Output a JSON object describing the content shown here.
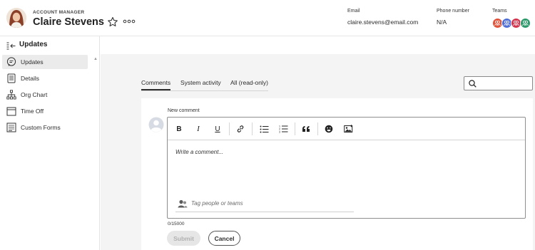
{
  "header": {
    "role": "ACCOUNT MANAGER",
    "name": "Claire Stevens",
    "email_label": "Email",
    "email_value": "claire.stevens@email.com",
    "phone_label": "Phone number",
    "phone_value": "N/A",
    "teams_label": "Teams",
    "team_badges": [
      {
        "color": "#e0533a",
        "icon": "team-icon"
      },
      {
        "color": "#4f6fd6",
        "icon": "team-icon"
      },
      {
        "color": "#d4364f",
        "icon": "team-icon"
      },
      {
        "color": "#2e9a6b",
        "icon": "team-icon"
      }
    ]
  },
  "sidebar": {
    "title": "Updates",
    "items": [
      {
        "label": "Updates",
        "icon": "chat-bubble-icon",
        "active": true
      },
      {
        "label": "Details",
        "icon": "document-icon",
        "active": false
      },
      {
        "label": "Org Chart",
        "icon": "org-chart-icon",
        "active": false
      },
      {
        "label": "Time Off",
        "icon": "calendar-icon",
        "active": false
      },
      {
        "label": "Custom Forms",
        "icon": "form-icon",
        "active": false
      }
    ]
  },
  "tabs": [
    {
      "label": "Comments",
      "active": true
    },
    {
      "label": "System activity",
      "active": false
    },
    {
      "label": "All (read-only)",
      "active": false
    }
  ],
  "search": {
    "placeholder": ""
  },
  "composer": {
    "label": "New comment",
    "placeholder": "Write a comment...",
    "tag_placeholder": "Tag people or teams",
    "counter": "0/15000",
    "submit_label": "Submit",
    "cancel_label": "Cancel",
    "toolbar": [
      {
        "name": "bold-button",
        "glyph": "B"
      },
      {
        "name": "italic-button",
        "glyph": "I"
      },
      {
        "name": "underline-button",
        "glyph": "U"
      },
      {
        "name": "link-button",
        "icon": "link-icon"
      },
      {
        "name": "bulleted-list-button",
        "icon": "bullet-list-icon"
      },
      {
        "name": "numbered-list-button",
        "icon": "numbered-list-icon"
      },
      {
        "name": "quote-button",
        "icon": "quote-icon"
      },
      {
        "name": "emoji-button",
        "icon": "emoji-icon"
      },
      {
        "name": "insert-image-button",
        "icon": "image-icon"
      }
    ]
  },
  "colors": {
    "accent_text": "#2c2c2c",
    "sidebar_active_bg": "#ebebeb",
    "main_bg": "#f4f4f4"
  }
}
